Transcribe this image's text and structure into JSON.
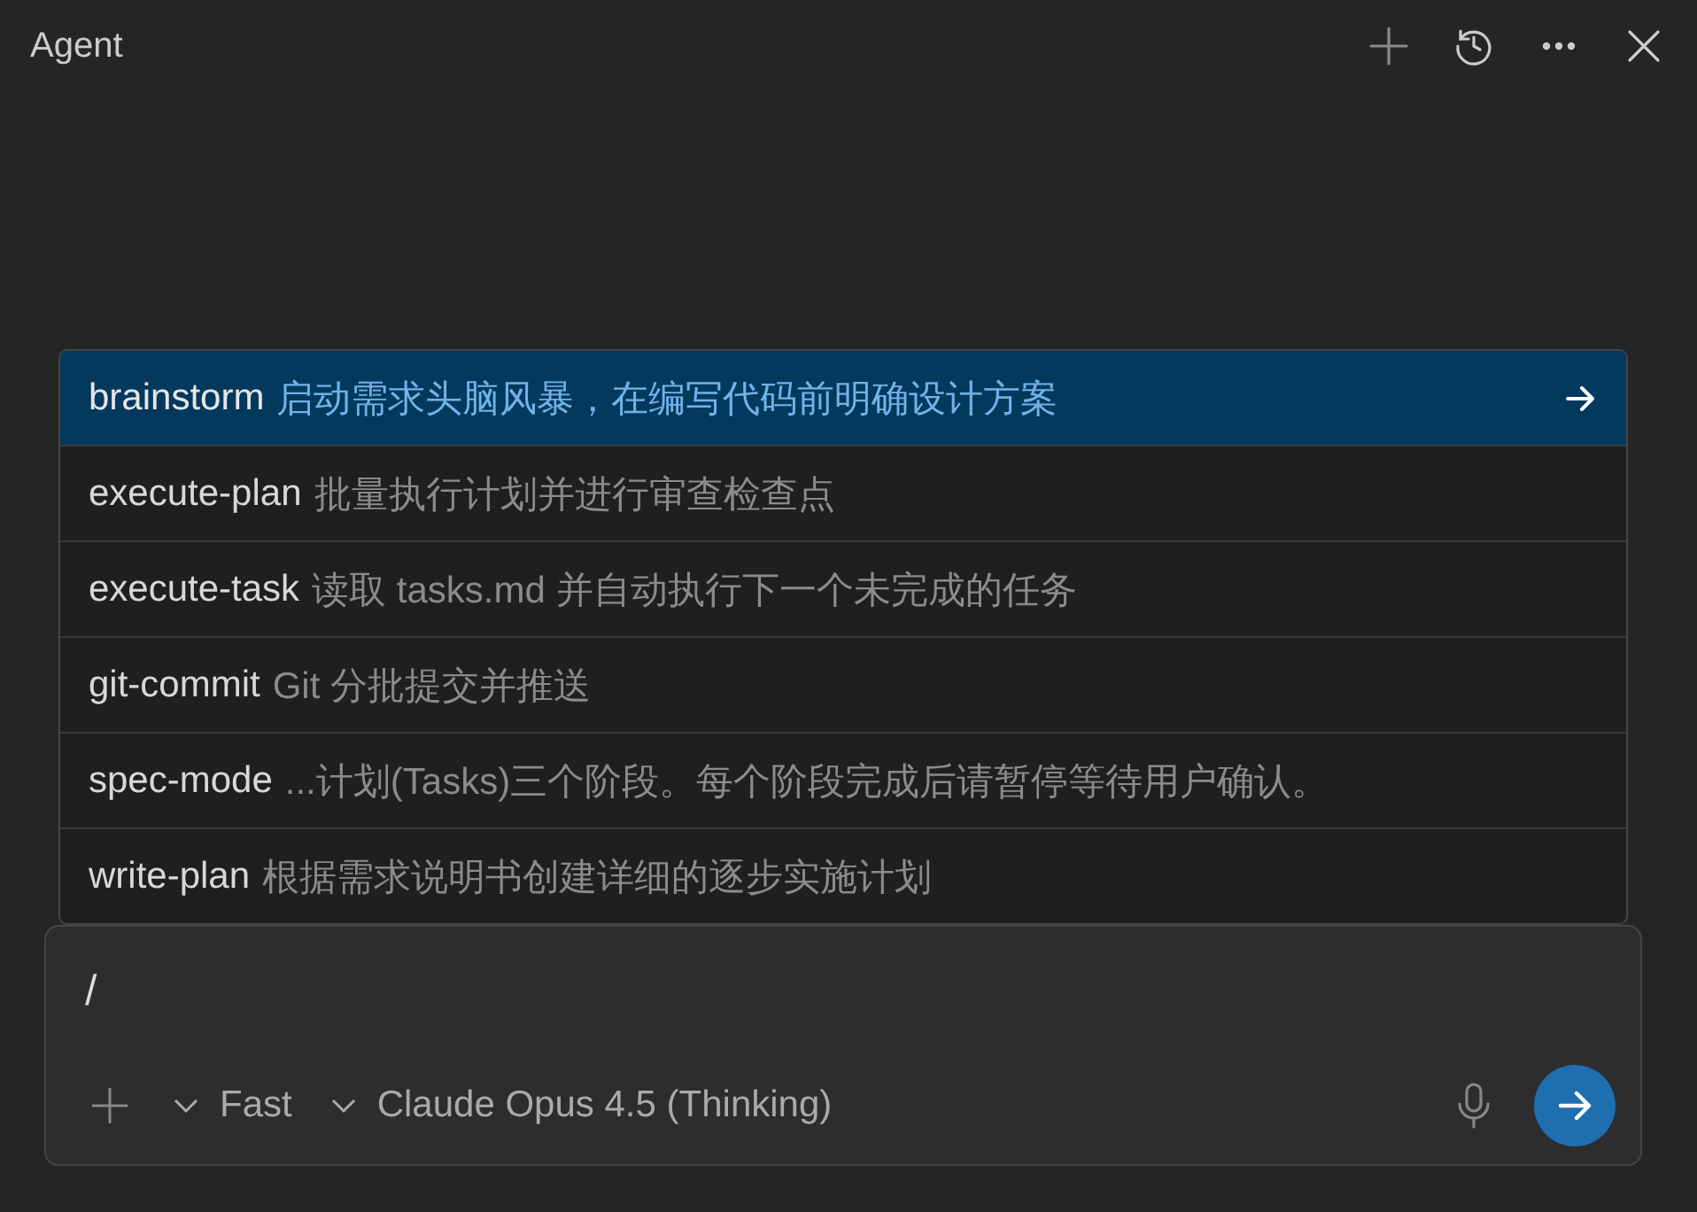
{
  "panel": {
    "title": "Agent"
  },
  "commands": [
    {
      "name": "brainstorm",
      "description": "启动需求头脑风暴，在编写代码前明确设计方案",
      "selected": true
    },
    {
      "name": "execute-plan",
      "description": "批量执行计划并进行审查检查点",
      "selected": false
    },
    {
      "name": "execute-task",
      "description": "读取 tasks.md 并自动执行下一个未完成的任务",
      "selected": false
    },
    {
      "name": "git-commit",
      "description": "Git 分批提交并推送",
      "selected": false
    },
    {
      "name": "spec-mode",
      "description": "...计划(Tasks)三个阶段。每个阶段完成后请暂停等待用户确认。",
      "selected": false
    },
    {
      "name": "write-plan",
      "description": "根据需求说明书创建详细的逐步实施计划",
      "selected": false
    }
  ],
  "composer": {
    "value": "/",
    "mode": "Fast",
    "model": "Claude Opus 4.5 (Thinking)"
  }
}
